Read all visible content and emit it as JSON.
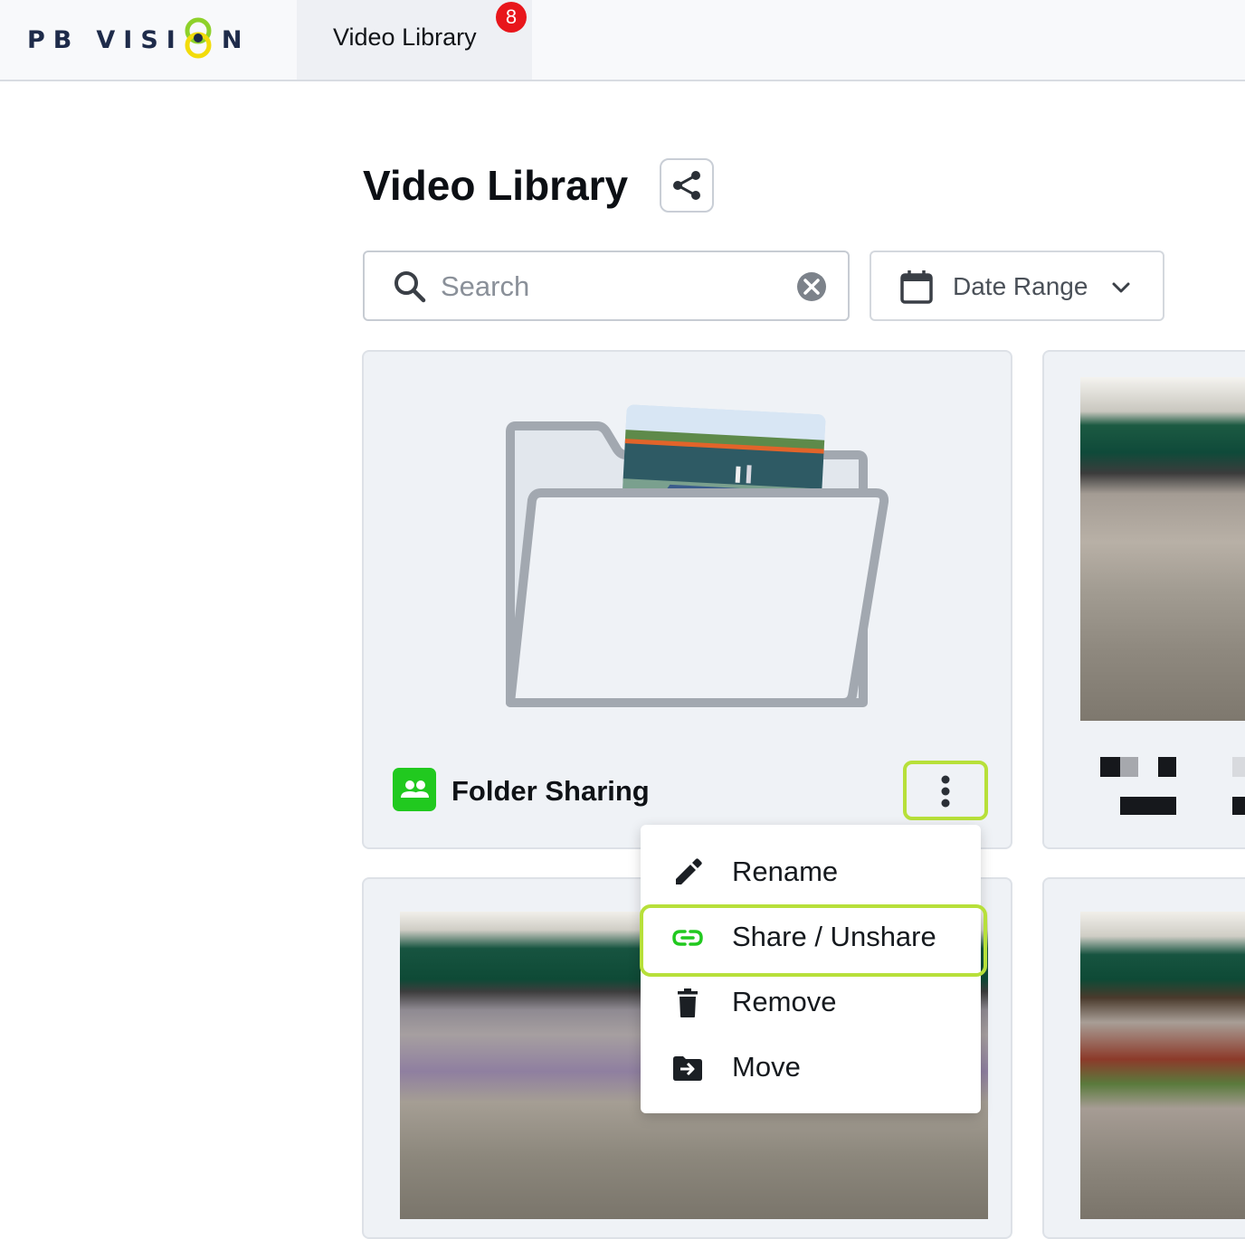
{
  "app": {
    "logo_text": "PB VISION",
    "logo_part1": "PB",
    "logo_part2": "VISI",
    "logo_part3": "N"
  },
  "nav": {
    "tabs": [
      {
        "label": "Video Library",
        "badge": "8",
        "active": true
      }
    ]
  },
  "page": {
    "title": "Video Library"
  },
  "search": {
    "placeholder": "Search",
    "value": ""
  },
  "filters": {
    "date_range_label": "Date Range"
  },
  "folder_card": {
    "name": "Folder Sharing",
    "shared": true
  },
  "context_menu": {
    "items": [
      {
        "label": "Rename",
        "icon": "pencil-icon"
      },
      {
        "label": "Share / Unshare",
        "icon": "link-icon",
        "highlighted": true
      },
      {
        "label": "Remove",
        "icon": "trash-icon"
      },
      {
        "label": "Move",
        "icon": "folder-move-icon"
      }
    ]
  },
  "colors": {
    "accent_green": "#21c91f",
    "highlight_lime": "#b7e03a",
    "badge_red": "#e8161b",
    "brand_navy": "#1e2b4a",
    "logo_ring_green": "#8ed12a",
    "logo_ring_yellow": "#f2dc0a"
  }
}
